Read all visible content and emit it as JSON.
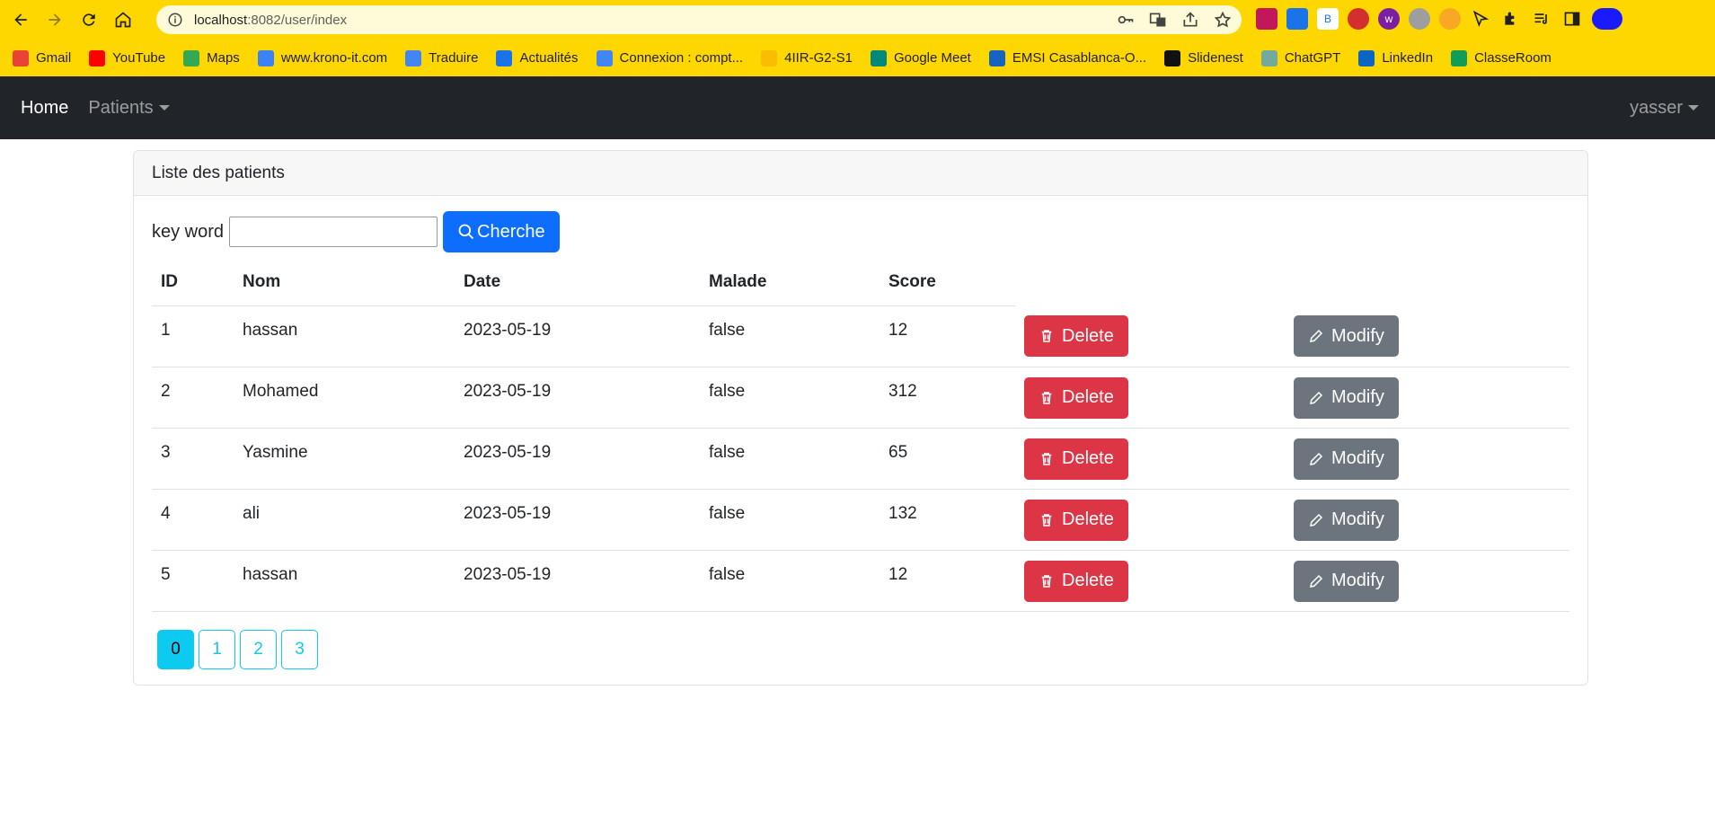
{
  "browser": {
    "url_host": "localhost",
    "url_rest": ":8082/user/index",
    "bookmarks": [
      {
        "label": "Gmail",
        "color": "#ea4335"
      },
      {
        "label": "YouTube",
        "color": "#ff0000"
      },
      {
        "label": "Maps",
        "color": "#34a853"
      },
      {
        "label": "www.krono-it.com",
        "color": "#3b82f6"
      },
      {
        "label": "Traduire",
        "color": "#4285f4"
      },
      {
        "label": "Actualités",
        "color": "#1a73e8"
      },
      {
        "label": "Connexion : compt...",
        "color": "#4285f4"
      },
      {
        "label": "4IIR-G2-S1",
        "color": "#fbbc04"
      },
      {
        "label": "Google Meet",
        "color": "#00897b"
      },
      {
        "label": "EMSI Casablanca-O...",
        "color": "#1565c0"
      },
      {
        "label": "Slidenest",
        "color": "#111111"
      },
      {
        "label": "ChatGPT",
        "color": "#74aa9c"
      },
      {
        "label": "LinkedIn",
        "color": "#0a66c2"
      },
      {
        "label": "ClasseRoom",
        "color": "#0f9d58"
      }
    ]
  },
  "nav": {
    "brand": "Home",
    "patients": "Patients",
    "user": "yasser"
  },
  "card": {
    "title": "Liste des patients",
    "keyword_label": "key word",
    "keyword_value": "",
    "search_button": "Cherche"
  },
  "table": {
    "headers": [
      "ID",
      "Nom",
      "Date",
      "Malade",
      "Score"
    ],
    "rows": [
      {
        "id": "1",
        "nom": "hassan",
        "date": "2023-05-19",
        "malade": "false",
        "score": "12"
      },
      {
        "id": "2",
        "nom": "Mohamed",
        "date": "2023-05-19",
        "malade": "false",
        "score": "312"
      },
      {
        "id": "3",
        "nom": "Yasmine",
        "date": "2023-05-19",
        "malade": "false",
        "score": "65"
      },
      {
        "id": "4",
        "nom": "ali",
        "date": "2023-05-19",
        "malade": "false",
        "score": "132"
      },
      {
        "id": "5",
        "nom": "hassan",
        "date": "2023-05-19",
        "malade": "false",
        "score": "12"
      }
    ],
    "delete_label": "Delete",
    "modify_label": "Modify"
  },
  "pagination": {
    "pages": [
      "0",
      "1",
      "2",
      "3"
    ],
    "active": "0"
  },
  "colors": {
    "chrome_bg": "#ffd700",
    "navbar_bg": "#212529",
    "primary": "#0d6efd",
    "danger": "#dc3545",
    "secondary": "#6c757d",
    "info": "#0dcaf0"
  }
}
